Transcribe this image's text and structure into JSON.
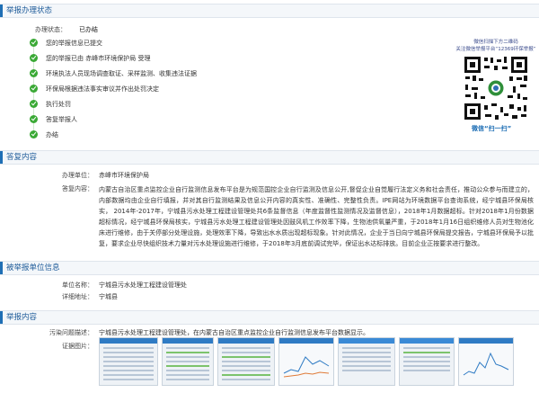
{
  "sections": {
    "status": "举报办理状态",
    "reply": "答复内容",
    "reported_unit": "被举报单位信息",
    "report": "举报内容"
  },
  "status": {
    "label": "办理状态：",
    "value": "已办结"
  },
  "steps": [
    "您的举报信息已提交",
    "您的举报已由 赤峰市环境保护局 受理",
    "环境执法人员现场调查取证、采样监测、收集违法证据",
    "环保局根据违法事实审议并作出处罚决定",
    "执行处罚",
    "答复举报人",
    "办结"
  ],
  "qr": {
    "line1": "微信扫描下方二维码",
    "line2": "关注微信举报平台“12369环保举报”",
    "scan": "微信“扫一扫”"
  },
  "reply": {
    "unit_label": "办理单位：",
    "unit_value": "赤峰市环境保护局",
    "content_label": "答复内容：",
    "content": "内蒙古自治区重点监控企业自行监测信息发布平台是为规范国控企业自行监测及信息公开,督促企业自觉履行法定义务和社会责任，推动公众参与而建立的，内部数据均由企业自行填报，并对其自行监测结果及信息公开内容的真实性、准确性、完整性负责。IPE网站为环境数据平台查询系统，经宁城县环保局核实， 2014年-2017年，宁城县污水处理工程建设管理处共6条监督信息（年度监督性监测情况及监督信息），2018年1月数据超标。针对2018年1月份数据超标情况，经宁城县环保局核实，宁城县污水处理工程建设管理处因鼓风机工作效率下降，生物池供氧量严重，于2018年1月16日组织维修人员对生物池化床进行维修，由于关停部分处理设施，处理效率下降，导致出水水质出现超标现象。针对此情况，企业于当日向宁城县环保局提交报告，宁城县环保局予以批复，要求企业尽快组织技术力量对污水处理设施进行维修，于2018年3月底前调试完毕，保证出水达标排放。目前企业正按要求进行整改。"
  },
  "reported": {
    "unit_label": "单位名称：",
    "unit_value": "宁城县污水处理工程建设管理处",
    "addr_label": "详细地址：",
    "addr_value": "宁城县"
  },
  "report": {
    "issue_label": "污染问题描述：",
    "issue_value": "宁城县污水处理工程建设管理处，在内蒙古自治区重点监控企业自行监测信息发布平台数据显示。",
    "evidence_label": "证据图片："
  },
  "colors": {
    "accent": "#1f6fb5",
    "step_done": "#3aa935"
  }
}
